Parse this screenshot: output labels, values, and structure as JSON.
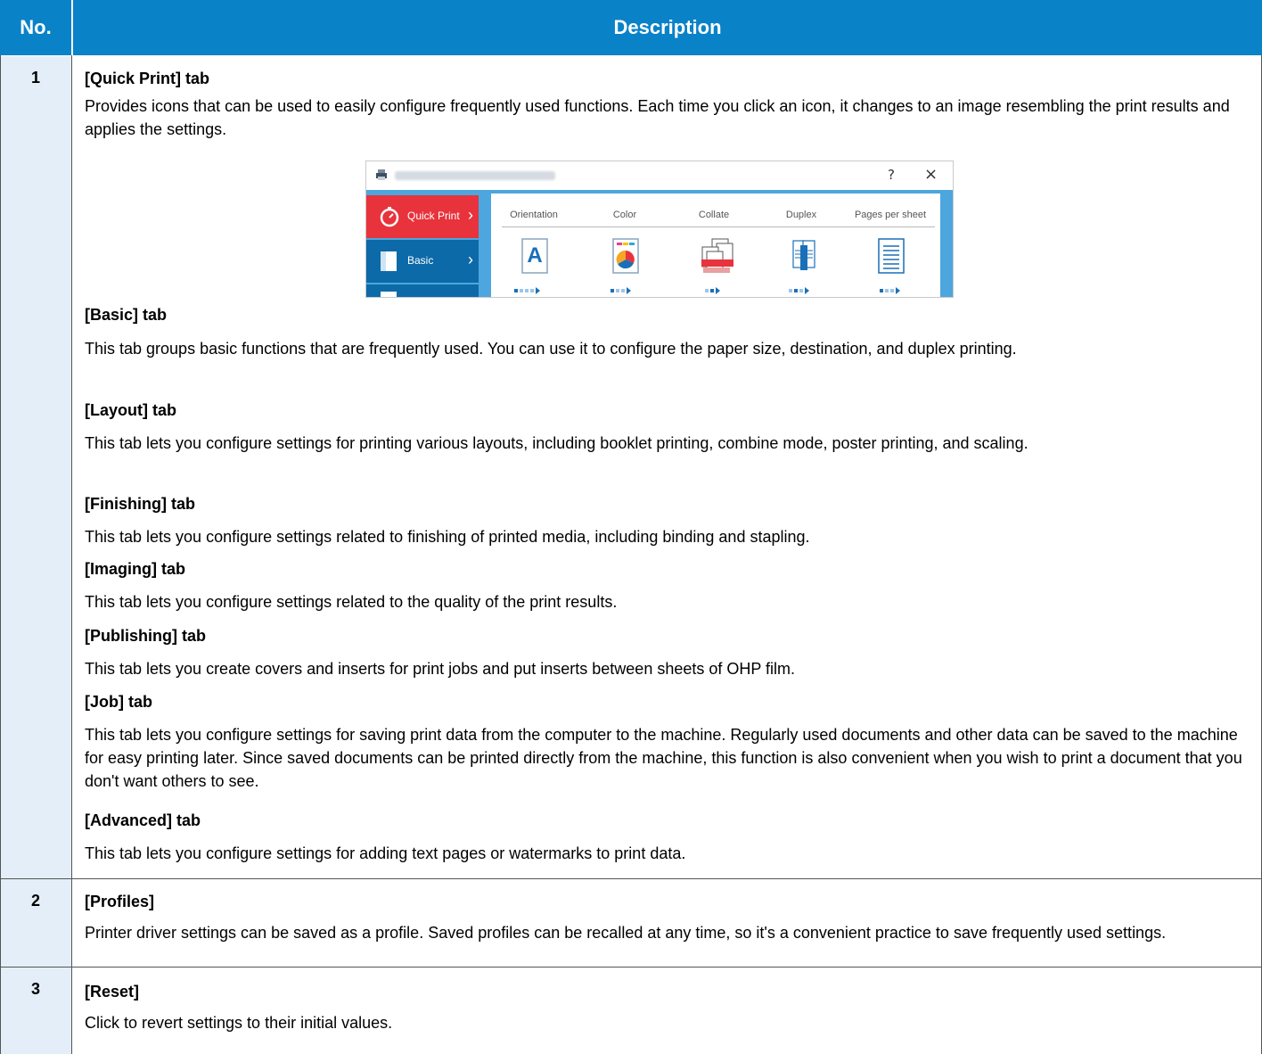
{
  "table": {
    "header_no": "No.",
    "header_desc": "Description"
  },
  "row1": {
    "no": "1",
    "quick_print_heading": "[Quick Print] tab",
    "quick_print_text": "Provides icons that can be used to easily configure frequently used functions. Each time you click an icon, it changes to an image resembling the print results and applies the settings.",
    "sections": [
      {
        "heading": "[Basic] tab",
        "text": "This tab groups basic functions that are frequently used. You can use it to configure the paper size, destination, and duplex printing."
      },
      {
        "heading": "[Layout] tab",
        "text": "This tab lets you configure settings for printing various layouts, including booklet printing, combine mode, poster printing, and scaling."
      },
      {
        "heading": "[Finishing] tab",
        "text": "This tab lets you configure settings related to finishing of printed media, including binding and stapling."
      },
      {
        "heading": "[Imaging] tab",
        "text": "This tab lets you configure settings related to the quality of the print results."
      },
      {
        "heading": "[Publishing] tab",
        "text": "This tab lets you create covers and inserts for print jobs and put inserts between sheets of OHP film."
      },
      {
        "heading": "[Job] tab",
        "text": "This tab lets you configure settings for saving print data from the computer to the machine. Regularly used documents and other data can be saved to the machine for easy printing later. Since saved documents can be printed directly from the machine, this function is also convenient when you wish to print a document that you don't want others to see."
      },
      {
        "heading": "[Advanced] tab",
        "text": "This tab lets you configure settings for adding text pages or watermarks to print data."
      }
    ]
  },
  "row2": {
    "no": "2",
    "heading": "[Profiles]",
    "text": "Printer driver settings can be saved as a profile. Saved profiles can be recalled at any time, so it's a convenient practice to save frequently used settings."
  },
  "row3": {
    "no": "3",
    "heading": "[Reset]",
    "text": "Click to revert settings to their initial values."
  },
  "screenshot": {
    "help_glyph": "?",
    "close_glyph": "×",
    "sidebar": [
      {
        "label": "Quick Print",
        "color": "#e8333c"
      },
      {
        "label": "Basic",
        "color": "#0d6aa8"
      }
    ],
    "columns": [
      "Orientation",
      "Color",
      "Collate",
      "Duplex",
      "Pages per sheet"
    ],
    "orientation_glyph": "A"
  }
}
